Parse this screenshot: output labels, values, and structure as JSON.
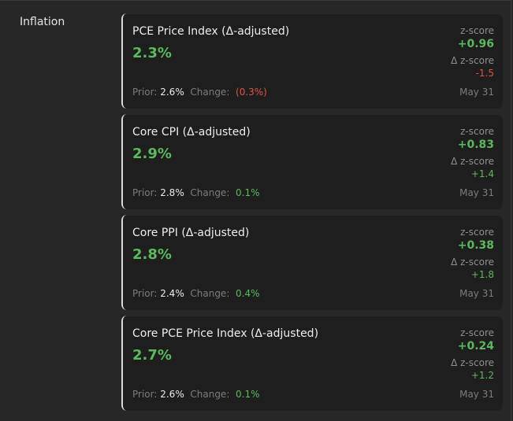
{
  "section": {
    "label": "Inflation"
  },
  "colors": {
    "positive": "#5cb85c",
    "negative": "#e0524b"
  },
  "cards": [
    {
      "title": "PCE Price Index (Δ-adjusted)",
      "value": "2.3%",
      "z_label": "z-score",
      "z_value": "+0.96",
      "dz_label": "Δ z-score",
      "dz_value": "-1.5",
      "dz_sign": "negative",
      "prior_label": "Prior:",
      "prior_value": "2.6%",
      "change_label": "Change:",
      "change_value": "(0.3%)",
      "change_sign": "negative",
      "date": "May 31"
    },
    {
      "title": "Core CPI (Δ-adjusted)",
      "value": "2.9%",
      "z_label": "z-score",
      "z_value": "+0.83",
      "dz_label": "Δ z-score",
      "dz_value": "+1.4",
      "dz_sign": "positive",
      "prior_label": "Prior:",
      "prior_value": "2.8%",
      "change_label": "Change:",
      "change_value": "0.1%",
      "change_sign": "positive",
      "date": "May 31"
    },
    {
      "title": "Core PPI (Δ-adjusted)",
      "value": "2.8%",
      "z_label": "z-score",
      "z_value": "+0.38",
      "dz_label": "Δ z-score",
      "dz_value": "+1.8",
      "dz_sign": "positive",
      "prior_label": "Prior:",
      "prior_value": "2.4%",
      "change_label": "Change:",
      "change_value": "0.4%",
      "change_sign": "positive",
      "date": "May 31"
    },
    {
      "title": "Core PCE Price Index (Δ-adjusted)",
      "value": "2.7%",
      "z_label": "z-score",
      "z_value": "+0.24",
      "dz_label": "Δ z-score",
      "dz_value": "+1.2",
      "dz_sign": "positive",
      "prior_label": "Prior:",
      "prior_value": "2.6%",
      "change_label": "Change:",
      "change_value": "0.1%",
      "change_sign": "positive",
      "date": "May 31"
    }
  ]
}
